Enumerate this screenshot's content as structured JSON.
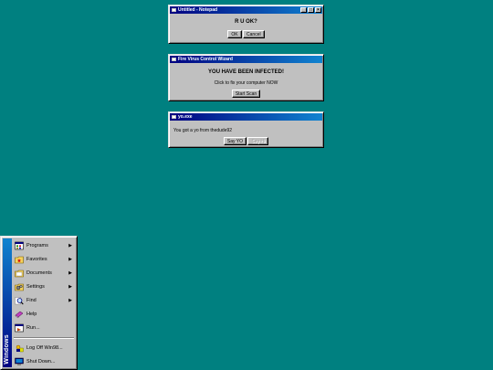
{
  "colors": {
    "desktop": "#008080",
    "titlebar": "#000080",
    "face": "#c0c0c0"
  },
  "notepad": {
    "title": "Untitled - Notepad",
    "message": "R U OK?",
    "ok_label": "OK",
    "cancel_label": "Cancel",
    "min_label": "_",
    "max_label": "□",
    "close_label": "×"
  },
  "virus": {
    "title": "Fire Virus Control Wizard",
    "headline": "YOU HAVE BEEN INFECTED!",
    "sub": "Click to fix your computer NOW",
    "button_label": "Start Scan"
  },
  "yo": {
    "title": "yo.exe",
    "message": "You got a yo from thedude92",
    "sayyo_label": "Say YO",
    "disabled_label": "Say Hi"
  },
  "start_menu": {
    "banner": "Windows",
    "items": [
      {
        "label": "Programs",
        "icon": "programs-icon",
        "submenu": true
      },
      {
        "label": "Favorites",
        "icon": "favorites-icon",
        "submenu": true
      },
      {
        "label": "Documents",
        "icon": "documents-icon",
        "submenu": true
      },
      {
        "label": "Settings",
        "icon": "settings-icon",
        "submenu": true
      },
      {
        "label": "Find",
        "icon": "find-icon",
        "submenu": true
      },
      {
        "label": "Help",
        "icon": "help-icon",
        "submenu": false
      },
      {
        "label": "Run...",
        "icon": "run-icon",
        "submenu": false
      },
      {
        "label": "Log Off Win98...",
        "icon": "logoff-icon",
        "submenu": false
      },
      {
        "label": "Shut Down...",
        "icon": "shutdown-icon",
        "submenu": false
      }
    ],
    "arrow": "▶"
  }
}
